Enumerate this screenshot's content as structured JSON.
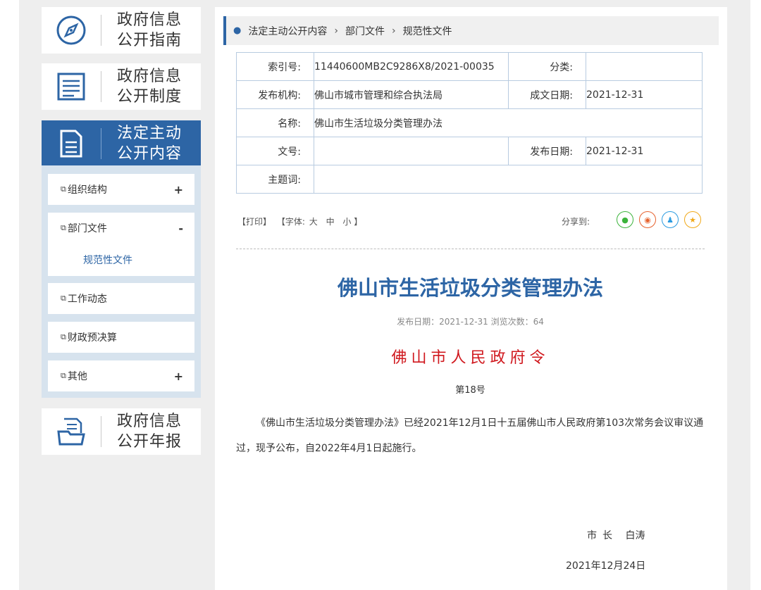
{
  "sidebar": {
    "cards": [
      {
        "line1": "政府信息",
        "line2": "公开指南",
        "icon": "compass-icon"
      },
      {
        "line1": "政府信息",
        "line2": "公开制度",
        "icon": "list-doc-icon"
      },
      {
        "line1": "法定主动",
        "line2": "公开内容",
        "icon": "document-icon"
      },
      {
        "line1": "政府信息",
        "line2": "公开年报",
        "icon": "folder-doc-icon"
      }
    ],
    "submenu": [
      {
        "label": "组织结构",
        "toggle": "+"
      },
      {
        "label": "部门文件",
        "toggle": "-",
        "child": "规范性文件"
      },
      {
        "label": "工作动态"
      },
      {
        "label": "财政预决算"
      },
      {
        "label": "其他",
        "toggle": "+"
      }
    ]
  },
  "breadcrumb": [
    "法定主动公开内容",
    "部门文件",
    "规范性文件"
  ],
  "meta": {
    "index_label": "索引号:",
    "index_value": "11440600MB2C9286X8/2021-00035",
    "category_label": "分类:",
    "category_value": "",
    "publisher_label": "发布机构:",
    "publisher_value": "佛山市城市管理和综合执法局",
    "written_label": "成文日期:",
    "written_value": "2021-12-31",
    "name_label": "名称:",
    "name_value": "佛山市生活垃圾分类管理办法",
    "docno_label": "文号:",
    "docno_value": "",
    "pubdate_label": "发布日期:",
    "pubdate_value": "2021-12-31",
    "keywords_label": "主题词:",
    "keywords_value": ""
  },
  "toolbar": {
    "print": "【打印】",
    "font_prefix": "【字体:",
    "font_large": "大",
    "font_medium": "中",
    "font_small": "小",
    "font_suffix": "】",
    "share_label": "分享到:"
  },
  "article": {
    "title": "佛山市生活垃圾分类管理办法",
    "info": "发布日期：2021-12-31   浏览次数：64",
    "decree": "佛山市人民政府令",
    "decree_no": "第18号",
    "body": "《佛山市生活垃圾分类管理办法》已经2021年12月1日十五届佛山市人民政府第103次常务会议审议通过，现予公布，自2022年4月1日起施行。",
    "mayor_title": "市长",
    "mayor_name": "白涛",
    "sign_date": "2021年12月24日"
  },
  "colors": {
    "brand": "#2d65a5",
    "decree_red": "#d0181e",
    "wechat": "#3bb33b",
    "weibo": "#e6612d",
    "qq": "#2b9be0",
    "qzone": "#f0a817"
  }
}
